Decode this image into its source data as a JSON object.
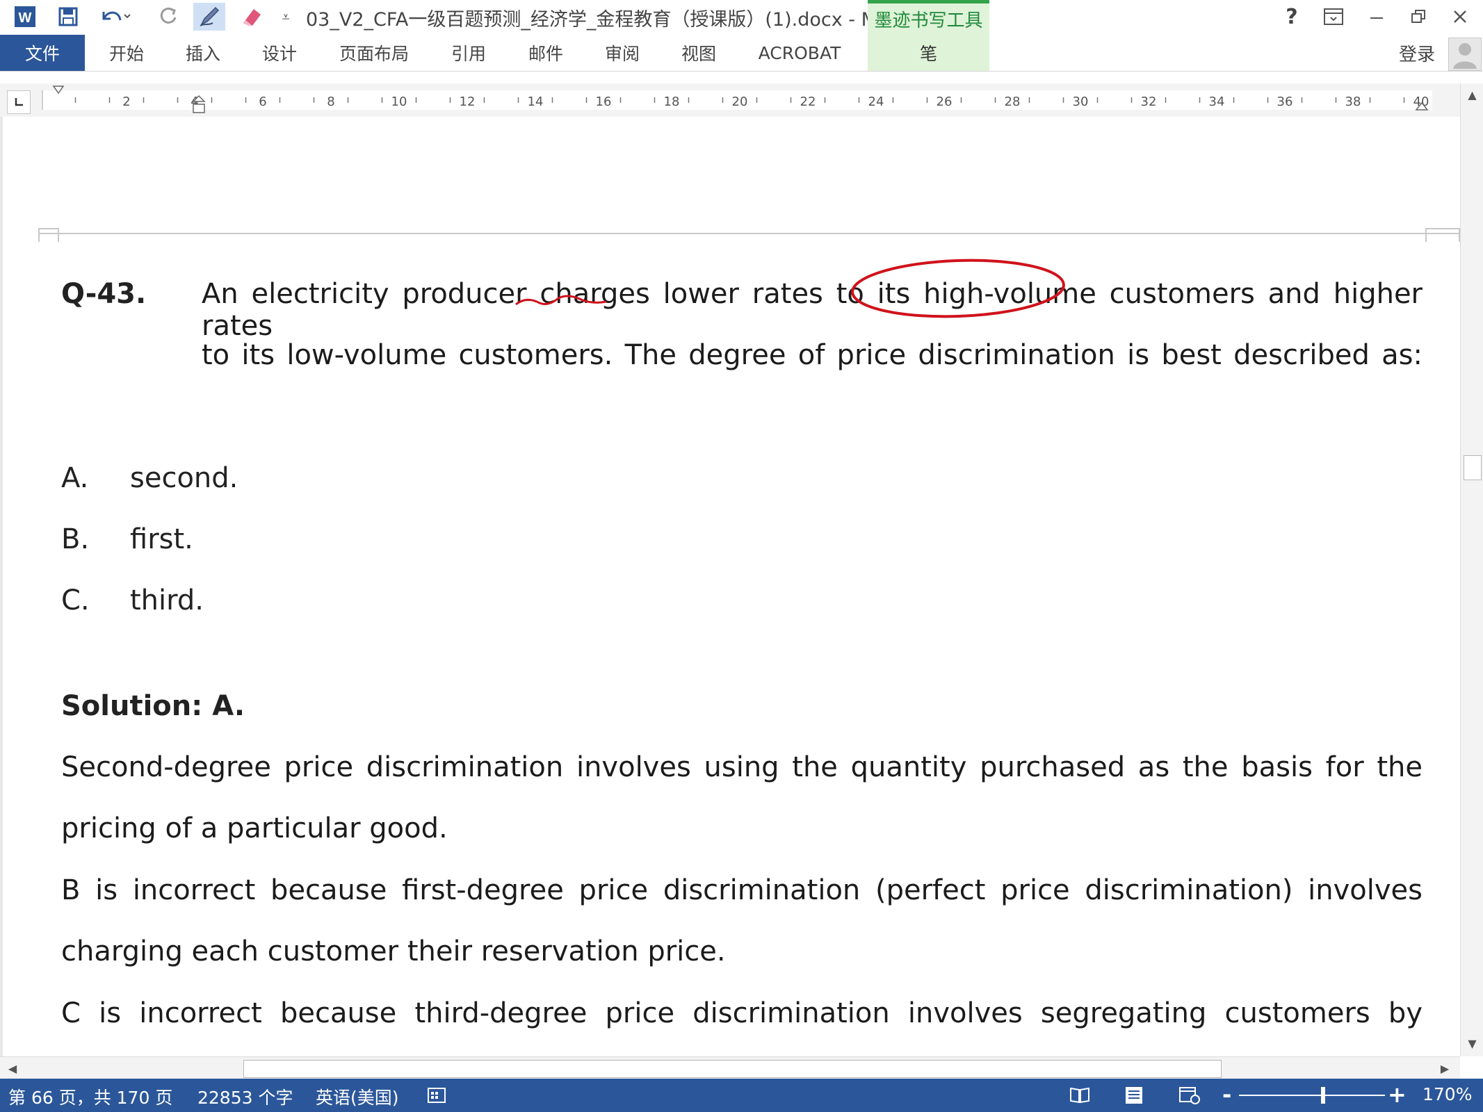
{
  "titlebar": {
    "doc_title": "03_V2_CFA一级百题预测_经济学_金程教育（授课版）(1).docx - M...",
    "ink_tools": "墨迹书写工具",
    "help": "?",
    "icons": [
      "word-app-icon",
      "save-icon",
      "undo-icon",
      "redo-icon",
      "pen-icon",
      "eraser-icon",
      "customize-qat-icon"
    ]
  },
  "ribbon": {
    "tabs": [
      "文件",
      "开始",
      "插入",
      "设计",
      "页面布局",
      "引用",
      "邮件",
      "审阅",
      "视图",
      "ACROBAT",
      "笔"
    ],
    "login": "登录"
  },
  "ruler": {
    "labels": [
      "2",
      "4",
      "6",
      "8",
      "10",
      "12",
      "14",
      "16",
      "18",
      "20",
      "22",
      "24",
      "26",
      "28",
      "30",
      "32",
      "34",
      "36",
      "38",
      "40"
    ]
  },
  "document": {
    "question_number": "Q-43.",
    "question_line1": "An electricity producer charges lower rates to its high-volume customers and higher rates",
    "question_line2": "to its low-volume customers. The degree of price discrimination is best described as:",
    "options": [
      {
        "letter": "A.",
        "text": "second."
      },
      {
        "letter": "B.",
        "text": "first."
      },
      {
        "letter": "C.",
        "text": "third."
      }
    ],
    "solution_title": "Solution: A.",
    "solution_lines": [
      "Second-degree price discrimination involves using the quantity purchased as the basis for the",
      "pricing of a particular good.",
      "B is incorrect because first-degree price discrimination (perfect price discrimination) involves",
      "charging each customer their reservation price.",
      "C is incorrect because third-degree price discrimination involves segregating customers by"
    ],
    "ink_color": "#d0121b"
  },
  "statusbar": {
    "page_info": "第 66 页，共 170 页",
    "word_count": "22853 个字",
    "language": "英语(美国)",
    "zoom_level": "170%",
    "zoom_minus": "-",
    "zoom_plus": "+"
  },
  "colors": {
    "accent": "#2b579a",
    "ink_tab": "#dff3d8",
    "ink_tab_border": "#33a34a"
  }
}
